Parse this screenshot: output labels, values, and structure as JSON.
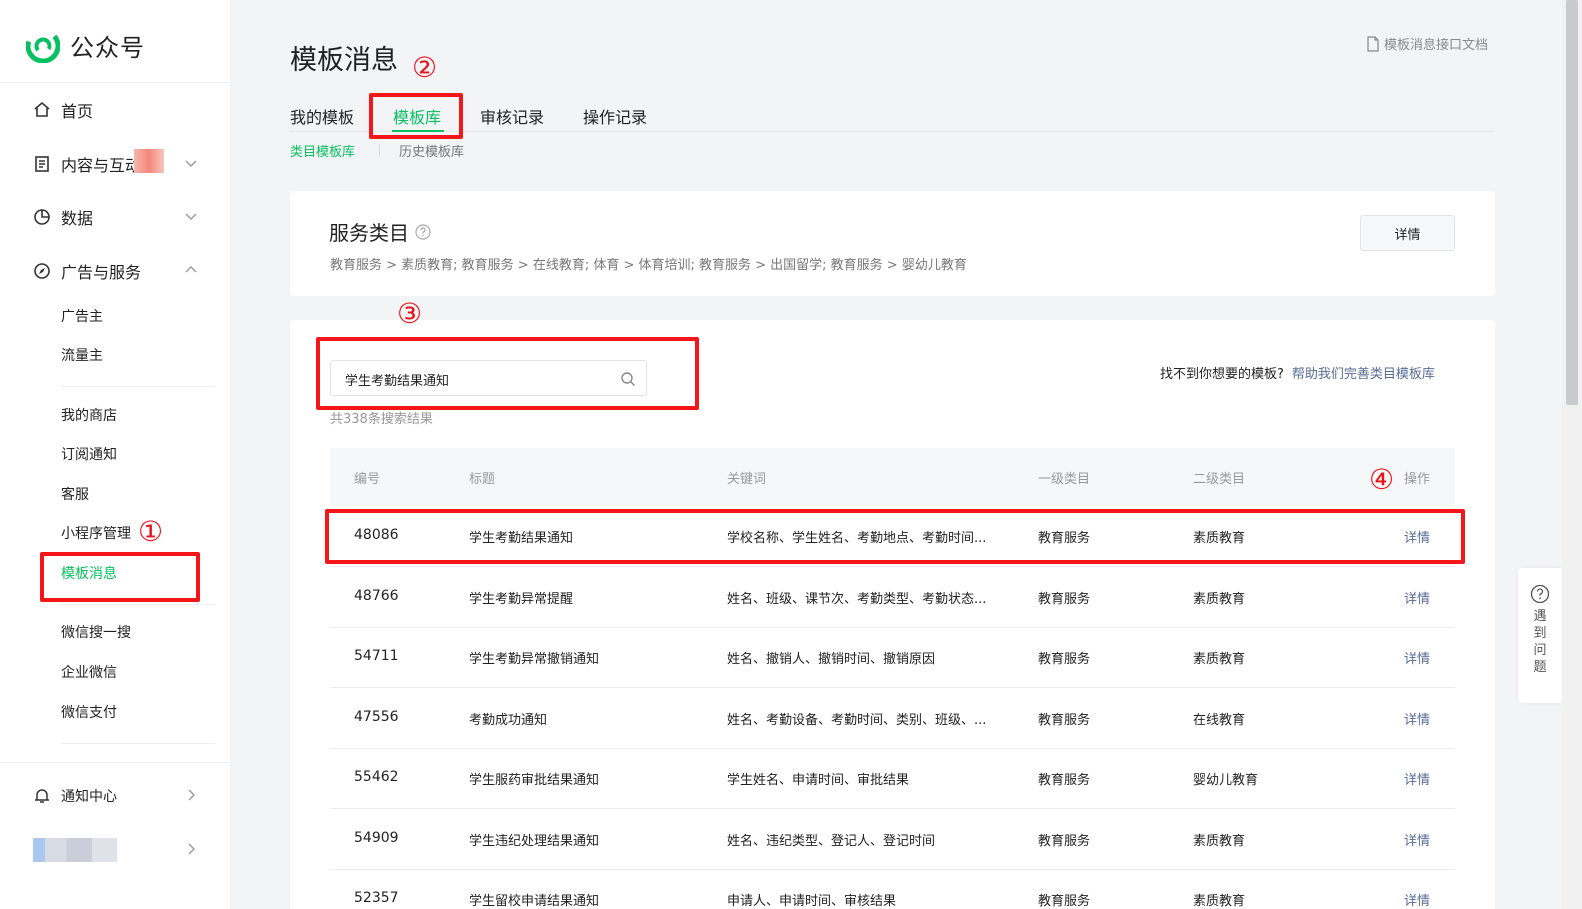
{
  "sidebar": {
    "logo_text": "公众号",
    "nav": {
      "home": "首页",
      "content": "内容与互动",
      "data": "数据",
      "ads": "广告与服务"
    },
    "sub": {
      "advertiser": "广告主",
      "publisher": "流量主",
      "shop": "我的商店",
      "subscribe": "订阅通知",
      "service": "客服",
      "miniprogram": "小程序管理",
      "template": "模板消息",
      "search": "微信搜一搜",
      "work": "企业微信",
      "pay": "微信支付"
    },
    "notify": "通知中心"
  },
  "header": {
    "title": "模板消息",
    "doc_link": "模板消息接口文档"
  },
  "tabs": {
    "my": "我的模板",
    "library": "模板库",
    "review": "审核记录",
    "ops": "操作记录"
  },
  "subtabs": {
    "category": "类目模板库",
    "history": "历史模板库"
  },
  "service": {
    "title": "服务类目",
    "path": "教育服务 > 素质教育; 教育服务 > 在线教育; 体育 > 体育培训; 教育服务 > 出国留学; 教育服务 > 婴幼儿教育",
    "detail_button": "详情"
  },
  "search": {
    "value": "学生考勤结果通知",
    "result_count": "共338条搜索结果",
    "help_question": "找不到你想要的模板?",
    "help_link": "帮助我们完善类目模板库"
  },
  "table": {
    "headers": {
      "id": "编号",
      "title": "标题",
      "keywords": "关键词",
      "cat1": "一级类目",
      "cat2": "二级类目",
      "op": "操作"
    },
    "rows": [
      {
        "id": "48086",
        "title": "学生考勤结果通知",
        "keywords": "学校名称、学生姓名、考勤地点、考勤时间...",
        "cat1": "教育服务",
        "cat2": "素质教育",
        "op": "详情"
      },
      {
        "id": "48766",
        "title": "学生考勤异常提醒",
        "keywords": "姓名、班级、课节次、考勤类型、考勤状态...",
        "cat1": "教育服务",
        "cat2": "素质教育",
        "op": "详情"
      },
      {
        "id": "54711",
        "title": "学生考勤异常撤销通知",
        "keywords": "姓名、撤销人、撤销时间、撤销原因",
        "cat1": "教育服务",
        "cat2": "素质教育",
        "op": "详情"
      },
      {
        "id": "47556",
        "title": "考勤成功通知",
        "keywords": "姓名、考勤设备、考勤时间、类别、班级、...",
        "cat1": "教育服务",
        "cat2": "在线教育",
        "op": "详情"
      },
      {
        "id": "55462",
        "title": "学生服药审批结果通知",
        "keywords": "学生姓名、申请时间、审批结果",
        "cat1": "教育服务",
        "cat2": "婴幼儿教育",
        "op": "详情"
      },
      {
        "id": "54909",
        "title": "学生违纪处理结果通知",
        "keywords": "姓名、违纪类型、登记人、登记时间",
        "cat1": "教育服务",
        "cat2": "素质教育",
        "op": "详情"
      },
      {
        "id": "52357",
        "title": "学生留校申请结果通知",
        "keywords": "申请人、申请时间、审核结果",
        "cat1": "教育服务",
        "cat2": "素质教育",
        "op": "详情"
      }
    ]
  },
  "annotations": {
    "n1": "①",
    "n2": "②",
    "n3": "③",
    "n4": "④"
  },
  "float_help": "遇到问题",
  "colors": {
    "accent": "#07c160",
    "link": "#576b95",
    "annotation": "#f5161b"
  }
}
